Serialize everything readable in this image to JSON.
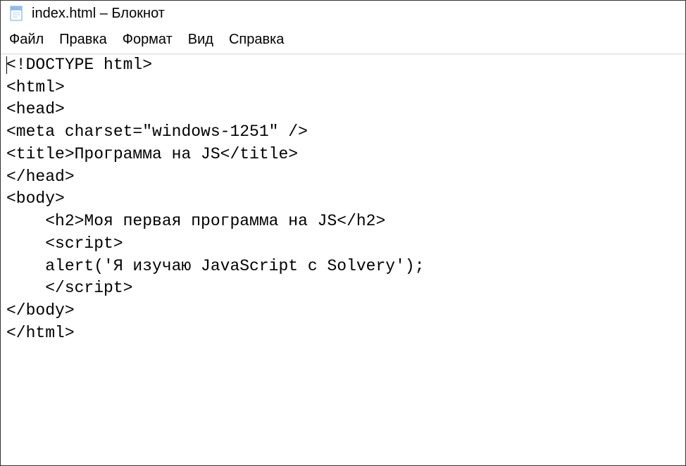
{
  "window": {
    "title": "index.html – Блокнот"
  },
  "menu": {
    "items": [
      "Файл",
      "Правка",
      "Формат",
      "Вид",
      "Справка"
    ]
  },
  "editor": {
    "lines": [
      "<!DOCTYPE html>",
      "<html>",
      "<head>",
      "<meta charset=\"windows-1251\" />",
      "<title>Программа на JS</title>",
      "</head>",
      "<body>",
      "    <h2>Моя первая программа на JS</h2>",
      "    <script>",
      "    alert('Я изучаю JavaScript c Solvery');",
      "    </script>",
      "</body>",
      "</html>"
    ]
  }
}
